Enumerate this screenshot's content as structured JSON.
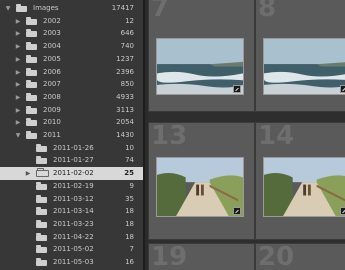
{
  "folders": [
    {
      "label": "Images",
      "count": "17417",
      "arrow": "▼",
      "level": 0
    },
    {
      "label": "2002",
      "count": "12",
      "arrow": "▶",
      "level": 1
    },
    {
      "label": "2003",
      "count": "646",
      "arrow": "▶",
      "level": 1
    },
    {
      "label": "2004",
      "count": "740",
      "arrow": "▶",
      "level": 1
    },
    {
      "label": "2005",
      "count": "1237",
      "arrow": "▶",
      "level": 1
    },
    {
      "label": "2006",
      "count": "2396",
      "arrow": "▶",
      "level": 1
    },
    {
      "label": "2007",
      "count": "850",
      "arrow": "▶",
      "level": 1
    },
    {
      "label": "2008",
      "count": "4933",
      "arrow": "▶",
      "level": 1
    },
    {
      "label": "2009",
      "count": "3113",
      "arrow": "▶",
      "level": 1
    },
    {
      "label": "2010",
      "count": "2054",
      "arrow": "▶",
      "level": 1
    },
    {
      "label": "2011",
      "count": "1430",
      "arrow": "▼",
      "level": 1
    },
    {
      "label": "2011-01-26",
      "count": "10",
      "arrow": "",
      "level": 2
    },
    {
      "label": "2011-01-27",
      "count": "74",
      "arrow": "",
      "level": 2
    },
    {
      "label": "2011-02-02",
      "count": "25",
      "arrow": "▶",
      "level": 2,
      "selected": true
    },
    {
      "label": "2011-02-19",
      "count": "9",
      "arrow": "",
      "level": 2
    },
    {
      "label": "2011-03-12",
      "count": "35",
      "arrow": "",
      "level": 2
    },
    {
      "label": "2011-03-14",
      "count": "18",
      "arrow": "",
      "level": 2
    },
    {
      "label": "2011-03-23",
      "count": "18",
      "arrow": "",
      "level": 2
    },
    {
      "label": "2011-04-22",
      "count": "18",
      "arrow": "",
      "level": 2
    },
    {
      "label": "2011-05-02",
      "count": "7",
      "arrow": "",
      "level": 2
    },
    {
      "label": "2011-05-03",
      "count": "16",
      "arrow": "",
      "level": 2
    }
  ],
  "grid": {
    "cells": [
      {
        "number": "7",
        "image": "sea"
      },
      {
        "number": "8",
        "image": "sea"
      },
      {
        "number": "13",
        "image": "path"
      },
      {
        "number": "14",
        "image": "path"
      },
      {
        "number": "19",
        "image": ""
      },
      {
        "number": "20",
        "image": ""
      }
    ]
  },
  "colors": {
    "panel": "#373737",
    "selected_row": "#d8d8d8",
    "grid_bg": "#2e2e2e"
  }
}
